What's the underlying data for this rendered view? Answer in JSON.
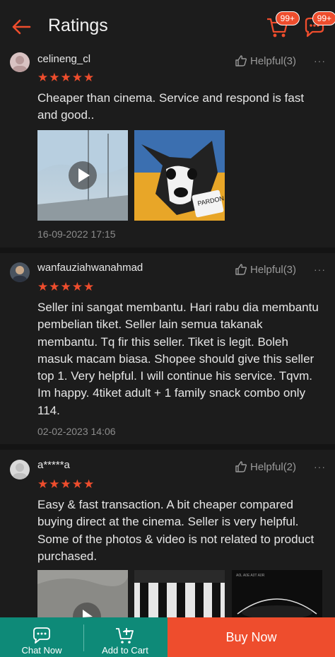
{
  "header": {
    "title": "Ratings",
    "cart_badge": "99+",
    "chat_badge": "99+"
  },
  "reviews": [
    {
      "username": "celineng_cl",
      "helpful": "Helpful(3)",
      "more": "···",
      "rating": 5,
      "comment": "Cheaper than cinema. Service and respond is fast and good..",
      "date": "16-09-2022 17:15",
      "media_label": "PARDON ME?"
    },
    {
      "username": "wanfauziahwanahmad",
      "helpful": "Helpful(3)",
      "more": "···",
      "rating": 5,
      "comment": "Seller ini sangat membantu.  Hari rabu dia membantu pembelian tiket.  Seller lain semua takanak membantu.  Tq fir this seller.  Tiket is legit.  Boleh masuk macam biasa.  Shopee should give this seller top 1. Very helpful.  I will continue his service.  Tqvm.  Im happy.  4tiket adult + 1 family snack combo only 114.",
      "date": "02-02-2023 14:06"
    },
    {
      "username": "a*****a",
      "helpful": "Helpful(2)",
      "more": "···",
      "rating": 5,
      "comment": "Easy & fast transaction. A bit cheaper compared buying direct at the cinema. Seller is very helpful. Some of the photos & video is not related to product purchased.",
      "media_caption": "A0L A0E A0T A0R"
    }
  ],
  "bottom_bar": {
    "chat_now": "Chat Now",
    "add_to_cart": "Add to Cart",
    "buy_now": "Buy Now"
  },
  "colors": {
    "accent": "#ee4d2d",
    "teal": "#0e8a78",
    "background": "#1c1c1c"
  }
}
